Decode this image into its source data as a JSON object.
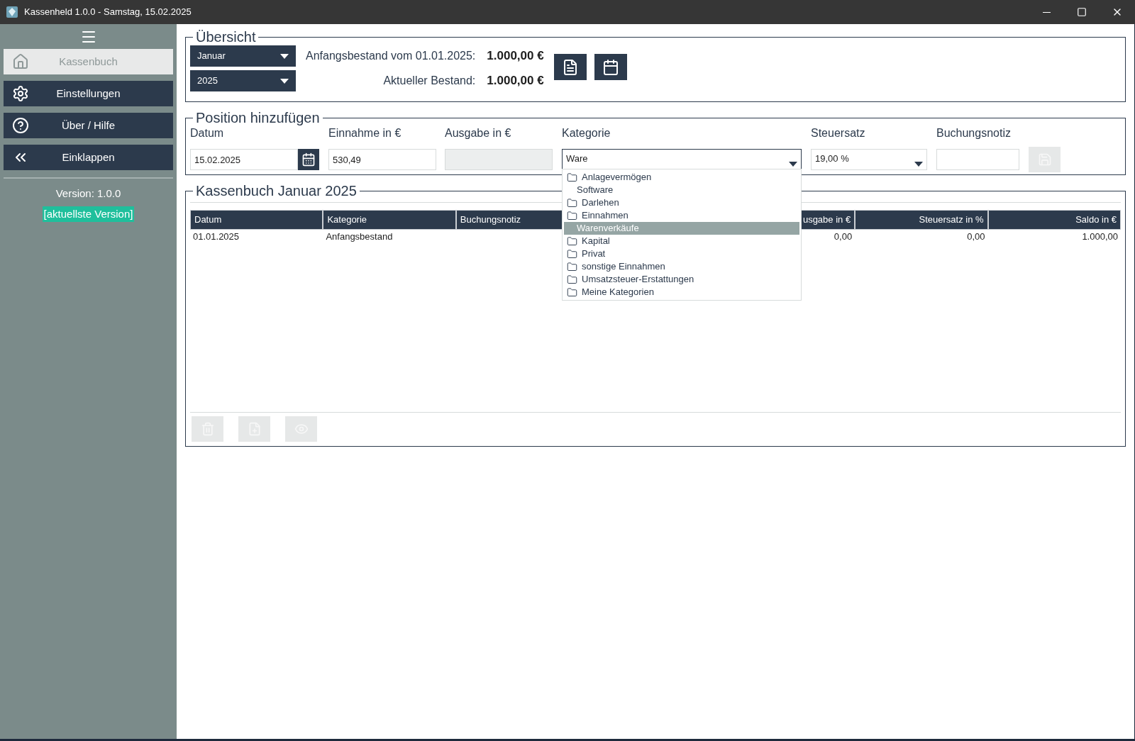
{
  "window": {
    "title": "Kassenheld 1.0.0 - Samstag, 15.02.2025"
  },
  "sidebar": {
    "items": [
      {
        "label": "Kassenbuch",
        "selected": true
      },
      {
        "label": "Einstellungen",
        "selected": false
      },
      {
        "label": "Über / Hilfe",
        "selected": false
      },
      {
        "label": "Einklappen",
        "selected": false
      }
    ],
    "version": "Version: 1.0.0",
    "update_link": "[aktuellste Version]"
  },
  "overview": {
    "title": "Übersicht",
    "month": "Januar",
    "year": "2025",
    "opening_label": "Anfangsbestand vom 01.01.2025:",
    "opening_value": "1.000,00 €",
    "current_label": "Aktueller Bestand:",
    "current_value": "1.000,00 €"
  },
  "add_position": {
    "title": "Position hinzufügen",
    "date": {
      "label": "Datum",
      "value": "15.02.2025"
    },
    "income": {
      "label": "Einnahme in €",
      "value": "530,49"
    },
    "expense": {
      "label": "Ausgabe in €",
      "disabled": true
    },
    "category": {
      "label": "Kategorie",
      "value": "Ware",
      "expanded": true,
      "options": [
        {
          "label": "Anlagevermögen",
          "selected": false,
          "children": [
            {
              "label": "Software",
              "selected": false
            }
          ]
        },
        {
          "label": "Darlehen",
          "selected": false
        },
        {
          "label": "Einnahmen",
          "selected": false,
          "children": [
            {
              "label": "Warenverkäufe",
              "selected": true
            }
          ]
        },
        {
          "label": "Kapital",
          "selected": false
        },
        {
          "label": "Privat",
          "selected": false
        },
        {
          "label": "sonstige Einnahmen",
          "selected": false
        },
        {
          "label": "Umsatzsteuer-Erstattungen",
          "selected": false
        },
        {
          "label": "Meine Kategorien",
          "selected": false
        }
      ]
    },
    "tax": {
      "label": "Steuersatz",
      "value": "19,00 %"
    },
    "note": {
      "label": "Buchungsnotiz"
    },
    "save_disabled": true
  },
  "ledger": {
    "title": "Kassenbuch Januar 2025",
    "columns": [
      {
        "header": "Datum"
      },
      {
        "header": "Kategorie"
      },
      {
        "header": "Buchungsnotiz"
      },
      {},
      {
        "header": "usgabe in €"
      },
      {
        "header": "Steuersatz in %"
      },
      {
        "header": "Saldo in €"
      }
    ],
    "rows": [
      [
        "01.01.2025",
        "Anfangsbestand",
        null,
        null,
        "0,00",
        "0,00",
        "1.000,00"
      ]
    ],
    "actions_disabled": true
  }
}
